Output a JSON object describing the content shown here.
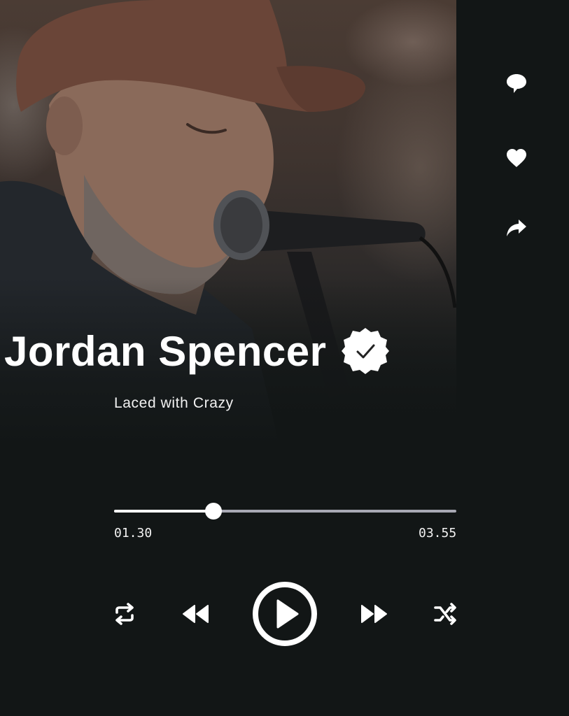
{
  "artist": {
    "name": "Jordan Spencer",
    "verified_icon": "verified-badge-icon"
  },
  "track": {
    "title": "Laced with Crazy"
  },
  "playback": {
    "elapsed": "01.30",
    "total": "03.55",
    "progress_fraction": 0.29,
    "state": "paused"
  },
  "actions": {
    "comment_icon": "comment-icon",
    "like_icon": "heart-icon",
    "share_icon": "share-icon"
  },
  "controls": {
    "repeat_icon": "repeat-icon",
    "previous_icon": "rewind-icon",
    "play_icon": "play-icon",
    "next_icon": "fast-forward-icon",
    "shuffle_icon": "shuffle-icon"
  },
  "colors": {
    "background": "#121616",
    "foreground": "#ffffff",
    "progress_track": "#a8a9b4"
  }
}
